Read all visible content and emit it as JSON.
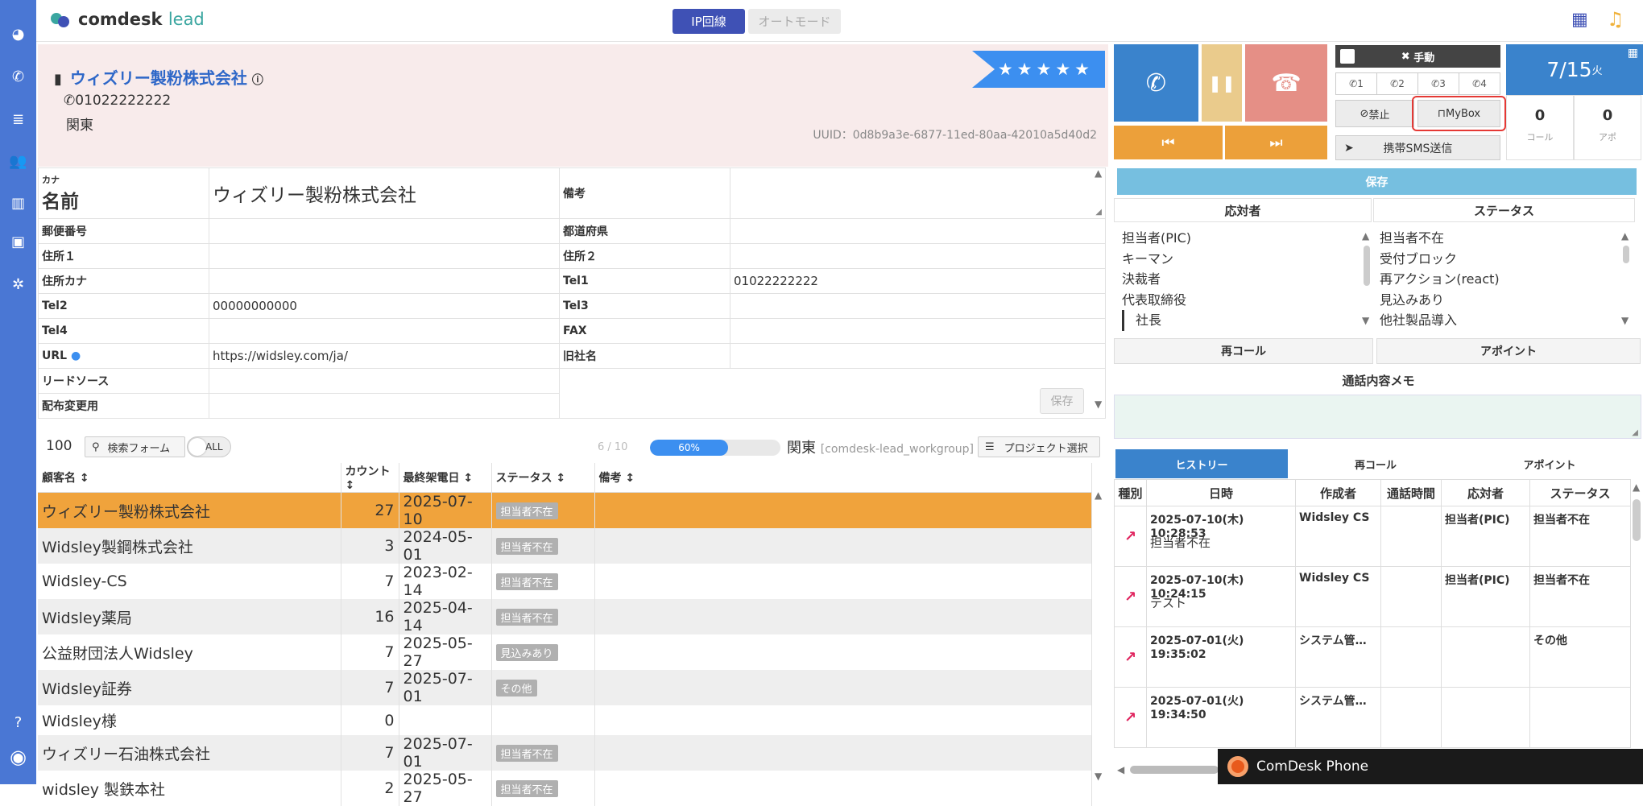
{
  "app": {
    "logo_main": "comdesk",
    "logo_sub": "lead",
    "mode_ip": "IP回線",
    "mode_auto": "オートモード"
  },
  "company": {
    "name": "ウィズリー製粉株式会社",
    "phone": "01022222222",
    "region": "関東",
    "uuid": "UUID：0d8b9a3e-6877-11ed-80aa-42010a5d40d2",
    "rating": "★★★★★"
  },
  "fields": {
    "kana_label": "カナ",
    "name_label": "名前",
    "name_value": "ウィズリー製粉株式会社",
    "remarks_label": "備考",
    "postal_label": "郵便番号",
    "pref_label": "都道府県",
    "addr1_label": "住所１",
    "addr2_label": "住所２",
    "addrkana_label": "住所カナ",
    "tel1_label": "Tel1",
    "tel1_value": "01022222222",
    "tel2_label": "Tel2",
    "tel2_value": "00000000000",
    "tel3_label": "Tel3",
    "tel4_label": "Tel4",
    "fax_label": "FAX",
    "url_label": "URL",
    "url_value": "https://widsley.com/ja/",
    "oldname_label": "旧社名",
    "leadsource_label": "リードソース",
    "dist_label": "配布変更用",
    "save_label": "保存"
  },
  "listbar": {
    "count": "100",
    "search": "検索フォーム",
    "toggle": "ALL",
    "page": "6 / 10",
    "progress_label": "60%",
    "progress_value": 0.6,
    "region": "関東",
    "group": "[comdesk-lead_workgroup]",
    "project": "プロジェクト選択"
  },
  "list": {
    "headers": [
      "顧客名",
      "カウント",
      "最終架電日",
      "ステータス",
      "備考"
    ],
    "rows": [
      {
        "name": "ウィズリー製粉株式会社",
        "count": "27",
        "date": "2025-07-10",
        "status": "担当者不在"
      },
      {
        "name": "Widsley製鋼株式会社",
        "count": "3",
        "date": "2024-05-01",
        "status": "担当者不在"
      },
      {
        "name": "Widsley-CS",
        "count": "7",
        "date": "2023-02-14",
        "status": "担当者不在"
      },
      {
        "name": "Widsley薬局",
        "count": "16",
        "date": "2025-04-14",
        "status": "担当者不在"
      },
      {
        "name": "公益財団法人Widsley",
        "count": "7",
        "date": "2025-05-27",
        "status": "見込みあり"
      },
      {
        "name": "Widsley証券",
        "count": "7",
        "date": "2025-07-01",
        "status": "その他"
      },
      {
        "name": "Widsley様",
        "count": "0",
        "date": "",
        "status": ""
      },
      {
        "name": "ウィズリー石油株式会社",
        "count": "7",
        "date": "2025-07-01",
        "status": "担当者不在"
      },
      {
        "name": "widsley 製鉄本社",
        "count": "2",
        "date": "2025-05-27",
        "status": "担当者不在"
      }
    ]
  },
  "phone": {
    "manual": "手動",
    "lines": [
      "1",
      "2",
      "3",
      "4"
    ],
    "ban": "禁止",
    "mybox": "MyBox",
    "sms": "携帯SMS送信",
    "date": "7/15",
    "weekday": "火",
    "calls": "0",
    "calls_label": "コール",
    "appts": "0",
    "appts_label": "アポ"
  },
  "result": {
    "save": "保存",
    "responder_head": "応対者",
    "status_head": "ステータス",
    "responders": [
      "担当者(PIC)",
      "キーマン",
      "決裁者",
      "代表取締役",
      "社長"
    ],
    "statuses": [
      "担当者不在",
      "受付ブロック",
      "再アクション(react)",
      "見込みあり",
      "他社製品導入"
    ],
    "recall": "再コール",
    "appoint": "アポイント",
    "memo_label": "通話内容メモ"
  },
  "history": {
    "tabs": [
      "ヒストリー",
      "再コール",
      "アポイント"
    ],
    "headers": [
      "種別",
      "日時",
      "作成者",
      "通話時間",
      "応対者",
      "ステータス"
    ],
    "rows": [
      {
        "date": "2025-07-10(木) 10:28:53",
        "by": "Widsley CS",
        "dur": "",
        "resp": "担当者(PIC)",
        "status": "担当者不在",
        "note": "担当者不在"
      },
      {
        "date": "2025-07-10(木) 10:24:15",
        "by": "Widsley CS",
        "dur": "",
        "resp": "担当者(PIC)",
        "status": "担当者不在",
        "note": "テスト"
      },
      {
        "date": "2025-07-01(火) 19:35:02",
        "by": "システム管…",
        "dur": "",
        "resp": "",
        "status": "その他",
        "note": ""
      },
      {
        "date": "2025-07-01(火) 19:34:50",
        "by": "システム管…",
        "dur": "",
        "resp": "",
        "status": "",
        "note": ""
      }
    ]
  },
  "popup": {
    "label": "ComDesk Phone"
  }
}
